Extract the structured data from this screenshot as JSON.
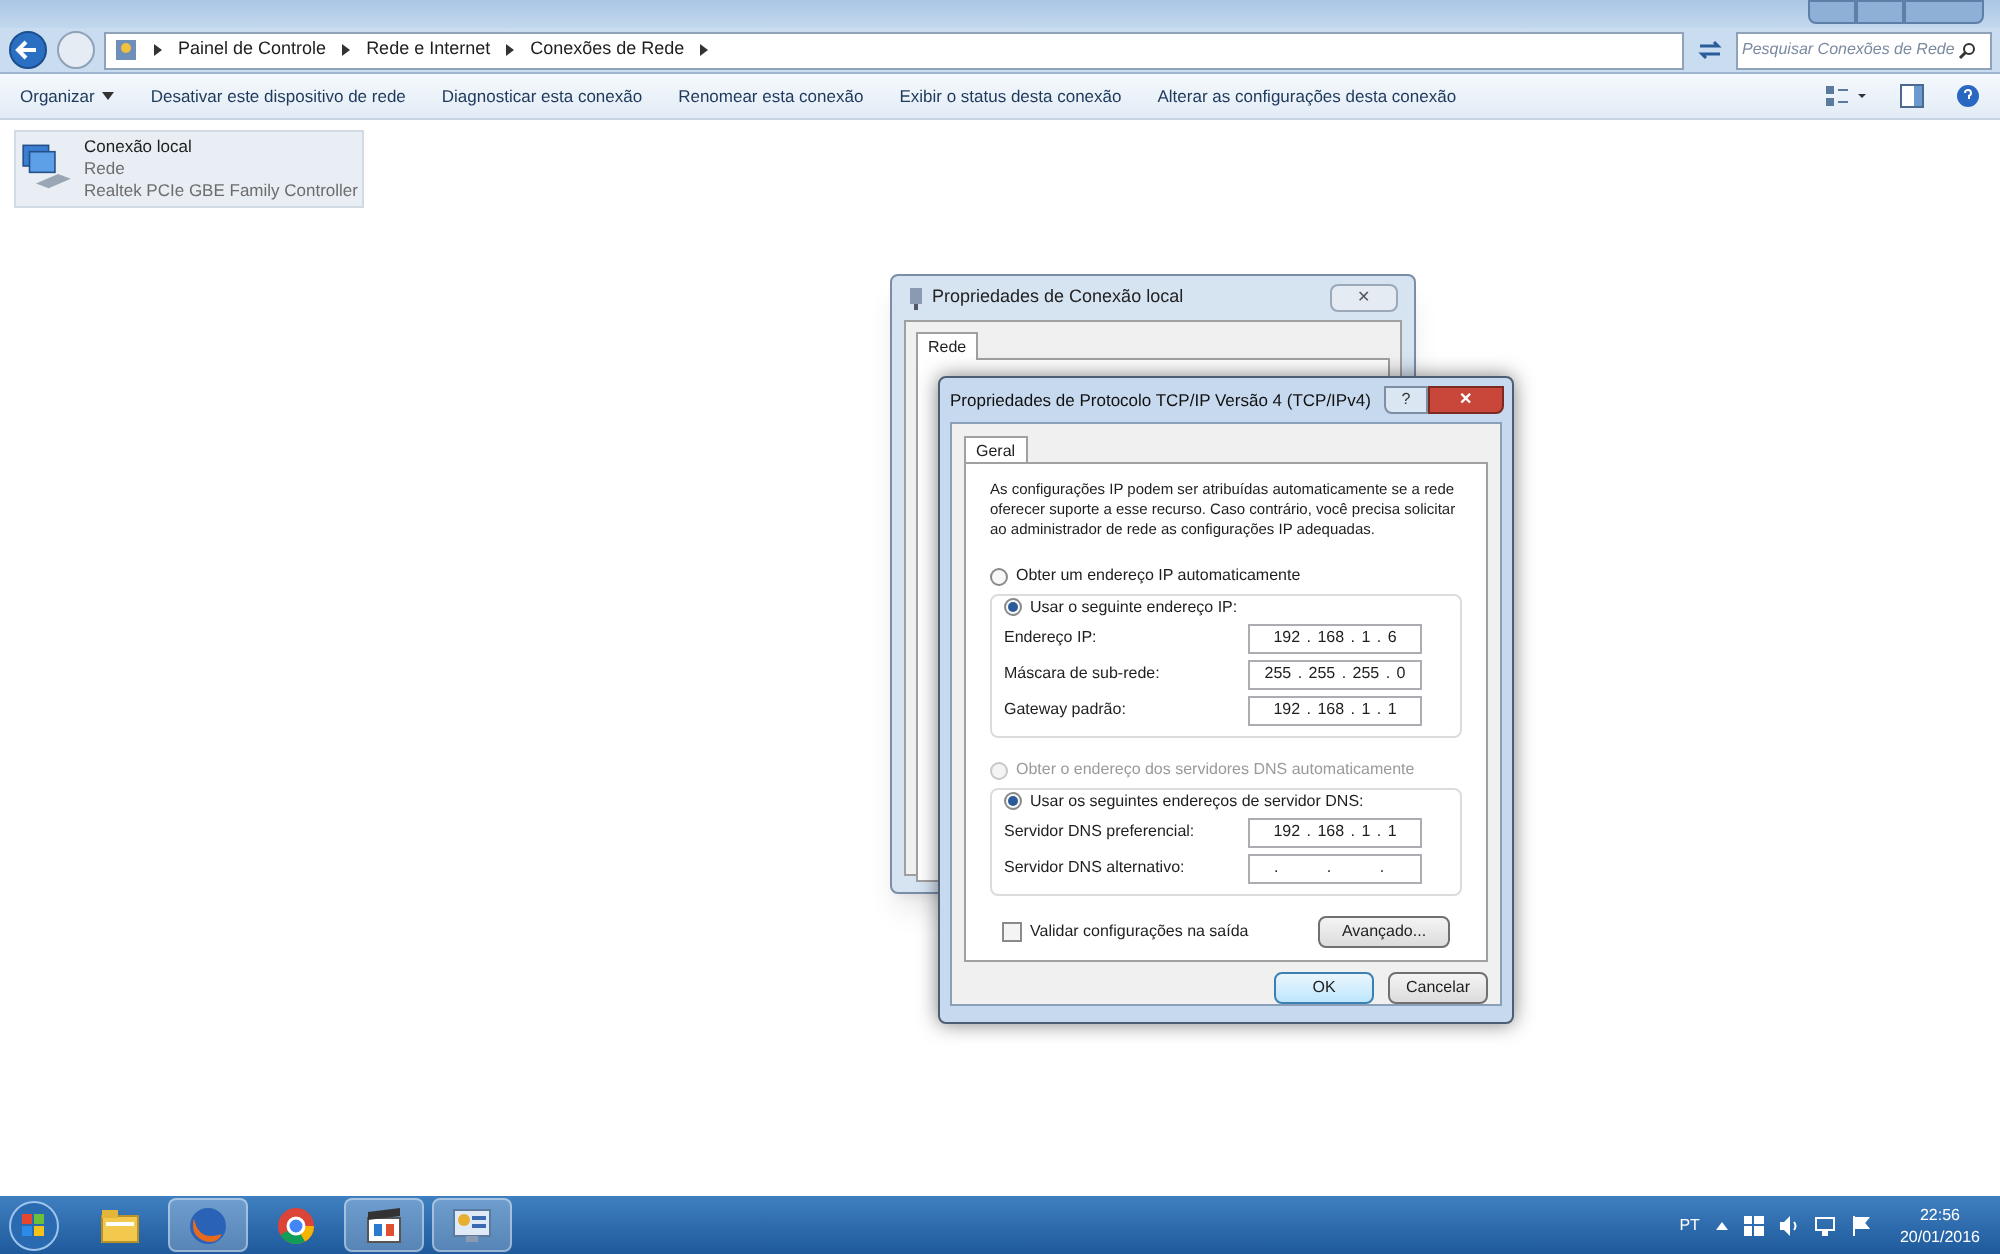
{
  "address_bar": {
    "crumbs": [
      "Painel de Controle",
      "Rede e Internet",
      "Conexões de Rede"
    ],
    "search_placeholder": "Pesquisar Conexões de Rede"
  },
  "toolbar": {
    "items": [
      "Organizar",
      "Desativar este dispositivo de rede",
      "Diagnosticar esta conexão",
      "Renomear esta conexão",
      "Exibir o status desta conexão",
      "Alterar as configurações desta conexão"
    ]
  },
  "connections": [
    {
      "name": "Conexão local",
      "network": "Rede",
      "adapter": "Realtek PCIe GBE Family Controller",
      "selected": true
    }
  ],
  "back_dialog": {
    "title": "Propriedades de Conexão local",
    "close": "✕",
    "tabs": [
      {
        "label": "Rede",
        "selected": true
      }
    ]
  },
  "dialog": {
    "title": "Propriedades de Protocolo TCP/IP Versão 4 (TCP/IPv4)",
    "help": "?",
    "close": "✕",
    "tabs": [
      {
        "label": "Geral",
        "selected": true
      }
    ],
    "description": "As configurações IP podem ser atribuídas automaticamente se a rede oferecer suporte a esse recurso. Caso contrário, você precisa solicitar ao administrador de rede as configurações IP adequadas.",
    "ip_options": [
      {
        "label": "Obter um endereço IP automaticamente",
        "selected": false,
        "disabled": false
      },
      {
        "label": "Usar o seguinte endereço IP:",
        "selected": true,
        "disabled": false
      }
    ],
    "ip_fields": [
      {
        "label": "Endereço IP:",
        "value": "192 . 168 . 1 . 6"
      },
      {
        "label": "Máscara de sub-rede:",
        "value": "255 . 255 . 255 . 0"
      },
      {
        "label": "Gateway padrão:",
        "value": "192 . 168 . 1 . 1"
      }
    ],
    "dns_options": [
      {
        "label": "Obter o endereço dos servidores DNS automaticamente",
        "selected": false,
        "disabled": true
      },
      {
        "label": "Usar os seguintes endereços de servidor DNS:",
        "selected": true,
        "disabled": false
      }
    ],
    "dns_fields": [
      {
        "label": "Servidor DNS preferencial:",
        "value": "192 . 168 . 1 . 1"
      },
      {
        "label": "Servidor DNS alternativo:",
        "value": ". . ."
      }
    ],
    "validate": {
      "label": "Validar configurações na saída",
      "checked": false
    },
    "advanced": "Avançado...",
    "ok": "OK",
    "cancel": "Cancelar"
  },
  "taskbar": {
    "apps": [
      {
        "kind": "folder",
        "active": false
      },
      {
        "kind": "firefox",
        "active": true
      },
      {
        "kind": "chrome",
        "active": false
      },
      {
        "kind": "media",
        "active": true
      },
      {
        "kind": "network",
        "active": true
      }
    ],
    "language": "PT",
    "time": "22:56",
    "date": "20/01/2016"
  }
}
